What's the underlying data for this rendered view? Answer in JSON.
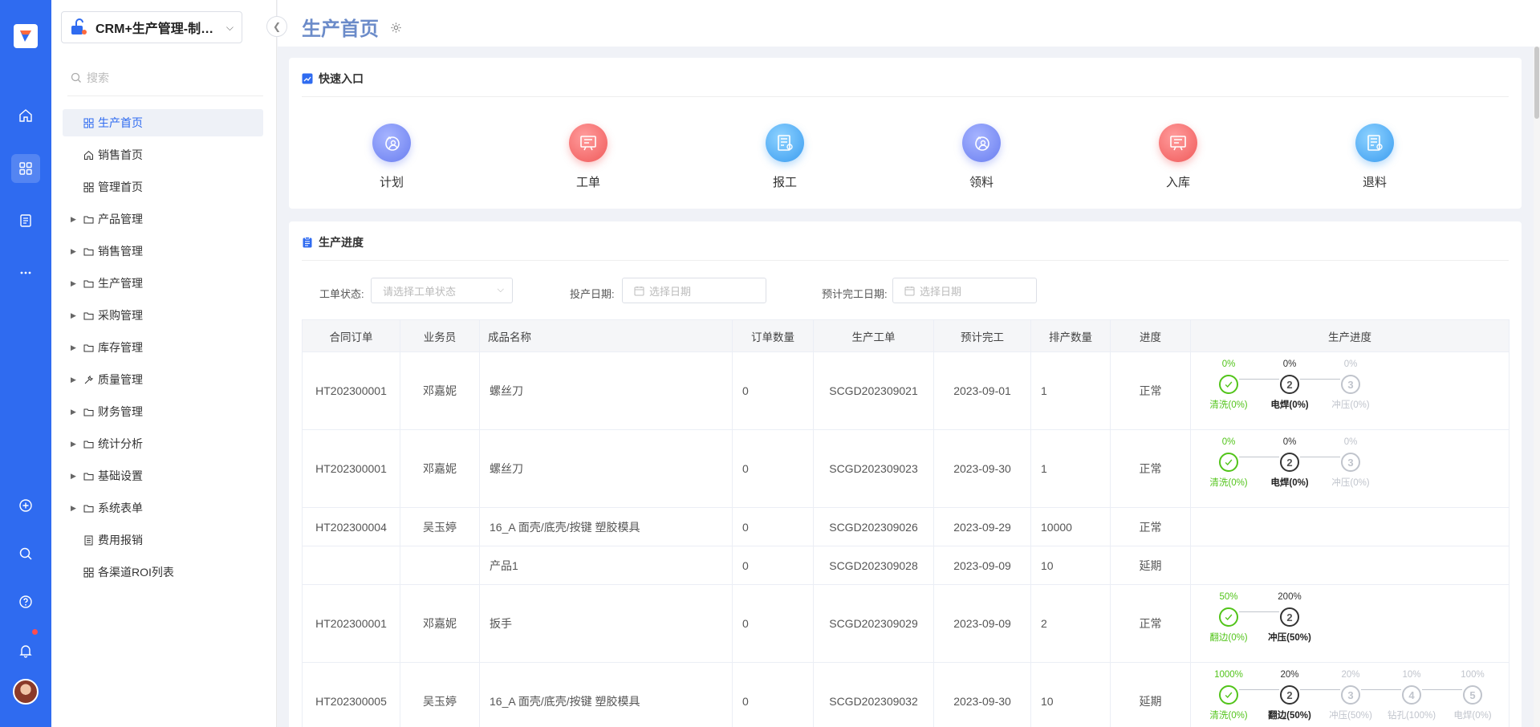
{
  "app": {
    "name": "CRM+生产管理-制造业",
    "search_placeholder": "搜索"
  },
  "menu": [
    {
      "label": "生产首页",
      "icon": "grid-icon",
      "expandable": false,
      "active": true
    },
    {
      "label": "销售首页",
      "icon": "home-icon",
      "expandable": false
    },
    {
      "label": "管理首页",
      "icon": "grid-icon",
      "expandable": false
    },
    {
      "label": "产品管理",
      "icon": "folder-icon",
      "expandable": true
    },
    {
      "label": "销售管理",
      "icon": "folder-icon",
      "expandable": true
    },
    {
      "label": "生产管理",
      "icon": "folder-icon",
      "expandable": true
    },
    {
      "label": "采购管理",
      "icon": "folder-icon",
      "expandable": true
    },
    {
      "label": "库存管理",
      "icon": "folder-icon",
      "expandable": true
    },
    {
      "label": "质量管理",
      "icon": "wrench-icon",
      "expandable": true
    },
    {
      "label": "财务管理",
      "icon": "folder-icon",
      "expandable": true
    },
    {
      "label": "统计分析",
      "icon": "folder-icon",
      "expandable": true
    },
    {
      "label": "基础设置",
      "icon": "folder-icon",
      "expandable": true
    },
    {
      "label": "系统表单",
      "icon": "folder-icon",
      "expandable": true
    },
    {
      "label": "费用报销",
      "icon": "form-icon",
      "expandable": false
    },
    {
      "label": "各渠道ROI列表",
      "icon": "grid-icon",
      "expandable": false
    }
  ],
  "page": {
    "title": "生产首页"
  },
  "quick_entry": {
    "title": "快速入口",
    "items": [
      {
        "label": "计划",
        "style": "purple",
        "icon": "plan-icon"
      },
      {
        "label": "工单",
        "style": "red",
        "icon": "workorder-icon"
      },
      {
        "label": "报工",
        "style": "blue",
        "icon": "report-icon"
      },
      {
        "label": "领料",
        "style": "purple",
        "icon": "material-pick-icon"
      },
      {
        "label": "入库",
        "style": "red",
        "icon": "stock-in-icon"
      },
      {
        "label": "退料",
        "style": "blue",
        "icon": "material-return-icon"
      }
    ]
  },
  "progress_section": {
    "title": "生产进度",
    "filters": {
      "status_label": "工单状态:",
      "status_placeholder": "请选择工单状态",
      "start_label": "投产日期:",
      "start_placeholder": "选择日期",
      "finish_label": "预计完工日期:",
      "finish_placeholder": "选择日期"
    },
    "columns": [
      "合同订单",
      "业务员",
      "成品名称",
      "订单数量",
      "生产工单",
      "预计完工",
      "排产数量",
      "进度",
      "生产进度"
    ],
    "rows": [
      {
        "contract": "HT202300001",
        "sales": "邓嘉妮",
        "product": "螺丝刀",
        "qty": "0",
        "wo": "SCGD202309021",
        "finish": "2023-09-01",
        "sched": "1",
        "status": "正常",
        "delayed": false,
        "steps": [
          {
            "pct": "0%",
            "name": "清洗(0%)",
            "state": "done"
          },
          {
            "pct": "0%",
            "name": "电焊(0%)",
            "state": "cur"
          },
          {
            "pct": "0%",
            "name": "冲压(0%)",
            "state": "todo"
          }
        ]
      },
      {
        "contract": "HT202300001",
        "sales": "邓嘉妮",
        "product": "螺丝刀",
        "qty": "0",
        "wo": "SCGD202309023",
        "finish": "2023-09-30",
        "sched": "1",
        "status": "正常",
        "delayed": false,
        "steps": [
          {
            "pct": "0%",
            "name": "清洗(0%)",
            "state": "done"
          },
          {
            "pct": "0%",
            "name": "电焊(0%)",
            "state": "cur"
          },
          {
            "pct": "0%",
            "name": "冲压(0%)",
            "state": "todo"
          }
        ]
      },
      {
        "contract": "HT202300004",
        "sales": "吴玉婷",
        "product": "16_A 面壳/底壳/按键 塑胶模具",
        "qty": "0",
        "wo": "SCGD202309026",
        "finish": "2023-09-29",
        "sched": "10000",
        "status": "正常",
        "delayed": false,
        "steps": []
      },
      {
        "contract": "",
        "sales": "",
        "product": "产品1",
        "qty": "0",
        "wo": "SCGD202309028",
        "finish": "2023-09-09",
        "sched": "10",
        "status": "延期",
        "delayed": true,
        "steps": []
      },
      {
        "contract": "HT202300001",
        "sales": "邓嘉妮",
        "product": "扳手",
        "qty": "0",
        "wo": "SCGD202309029",
        "finish": "2023-09-09",
        "sched": "2",
        "status": "正常",
        "delayed": false,
        "steps": [
          {
            "pct": "50%",
            "name": "翻边(0%)",
            "state": "done"
          },
          {
            "pct": "200%",
            "name": "冲压(50%)",
            "state": "cur"
          }
        ]
      },
      {
        "contract": "HT202300005",
        "sales": "吴玉婷",
        "product": "16_A 面壳/底壳/按键 塑胶模具",
        "qty": "0",
        "wo": "SCGD202309032",
        "finish": "2023-09-30",
        "sched": "10",
        "status": "延期",
        "delayed": true,
        "steps": [
          {
            "pct": "1000%",
            "name": "清洗(0%)",
            "state": "done"
          },
          {
            "pct": "20%",
            "name": "翻边(50%)",
            "state": "cur"
          },
          {
            "pct": "20%",
            "name": "冲压(50%)",
            "state": "todo"
          },
          {
            "pct": "10%",
            "name": "钻孔(100%)",
            "state": "todo"
          },
          {
            "pct": "100%",
            "name": "电焊(0%)",
            "state": "todo"
          }
        ]
      }
    ]
  },
  "colors": {
    "rail": "#2f6bf0",
    "accent": "#2f6bf0",
    "title": "#6b8bc9",
    "done": "#52c41a",
    "delay": "#f05a5a"
  }
}
